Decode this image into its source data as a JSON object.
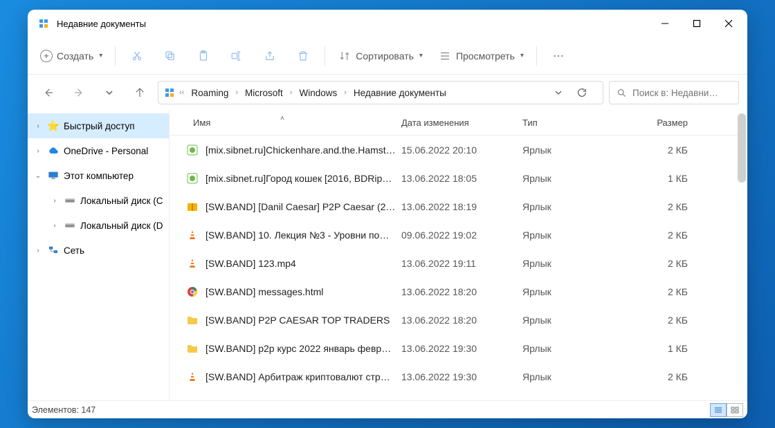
{
  "window": {
    "title": "Недавние документы"
  },
  "toolbar": {
    "create_label": "Создать",
    "sort_label": "Сортировать",
    "view_label": "Просмотреть"
  },
  "breadcrumb": {
    "segments": [
      "Roaming",
      "Microsoft",
      "Windows",
      "Недавние документы"
    ]
  },
  "search": {
    "placeholder": "Поиск в: Недавни…"
  },
  "sidebar": {
    "quick_access": "Быстрый доступ",
    "onedrive": "OneDrive - Personal",
    "this_pc": "Этот компьютер",
    "drive_c": "Локальный диск (C",
    "drive_d": "Локальный диск (D",
    "network": "Сеть"
  },
  "columns": {
    "name": "Имя",
    "date": "Дата изменения",
    "type": "Тип",
    "size": "Размер"
  },
  "files": [
    {
      "icon": "torrent",
      "name": "[mix.sibnet.ru]Chickenhare.and.the.Hamst…",
      "date": "15.06.2022 20:10",
      "type": "Ярлык",
      "size": "2 КБ"
    },
    {
      "icon": "torrent",
      "name": "[mix.sibnet.ru]Город кошек [2016, BDRip…",
      "date": "13.06.2022 18:05",
      "type": "Ярлык",
      "size": "1 КБ"
    },
    {
      "icon": "archive",
      "name": "[SW.BAND] [Danil Caesar] P2P Caesar (2…",
      "date": "13.06.2022 18:19",
      "type": "Ярлык",
      "size": "2 КБ"
    },
    {
      "icon": "vlc",
      "name": "[SW.BAND] 10. Лекция №3 - Уровни по…",
      "date": "09.06.2022 19:02",
      "type": "Ярлык",
      "size": "2 КБ"
    },
    {
      "icon": "vlc",
      "name": "[SW.BAND] 123.mp4",
      "date": "13.06.2022 19:11",
      "type": "Ярлык",
      "size": "2 КБ"
    },
    {
      "icon": "chrome",
      "name": "[SW.BAND] messages.html",
      "date": "13.06.2022 18:20",
      "type": "Ярлык",
      "size": "2 КБ"
    },
    {
      "icon": "folder",
      "name": "[SW.BAND] P2P CAESAR TOP TRADERS",
      "date": "13.06.2022 18:20",
      "type": "Ярлык",
      "size": "2 КБ"
    },
    {
      "icon": "folder",
      "name": "[SW.BAND] p2p курс 2022 январь февр…",
      "date": "13.06.2022 19:30",
      "type": "Ярлык",
      "size": "1 КБ"
    },
    {
      "icon": "vlc",
      "name": "[SW.BAND] Арбитраж криптовалют стр…",
      "date": "13.06.2022 19:30",
      "type": "Ярлык",
      "size": "2 КБ"
    }
  ],
  "status": {
    "count_label": "Элементов: 147"
  }
}
